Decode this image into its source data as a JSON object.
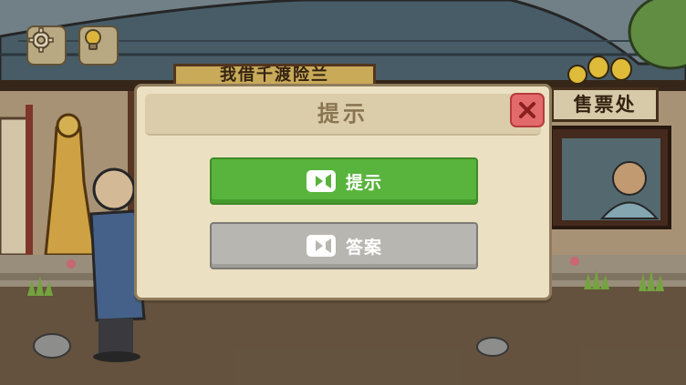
{
  "scene": {
    "sign_left_text": "我借千渡险兰",
    "sign_right_text": "售票处"
  },
  "toolbar": {
    "settings_icon": "gear-icon",
    "hint_icon": "lightbulb-icon"
  },
  "dialog": {
    "title": "提示",
    "close_icon": "close-icon",
    "buttons": [
      {
        "label": "提示",
        "icon": "video-camera-icon",
        "color": "#58b43c"
      },
      {
        "label": "答案",
        "icon": "video-camera-icon",
        "color": "#b8b6b1"
      }
    ]
  },
  "colors": {
    "dialog_bg": "#ece0c3",
    "close_red": "#e26a6a",
    "ad_green": "#58b43c",
    "ad_gray": "#b8b6b1"
  }
}
